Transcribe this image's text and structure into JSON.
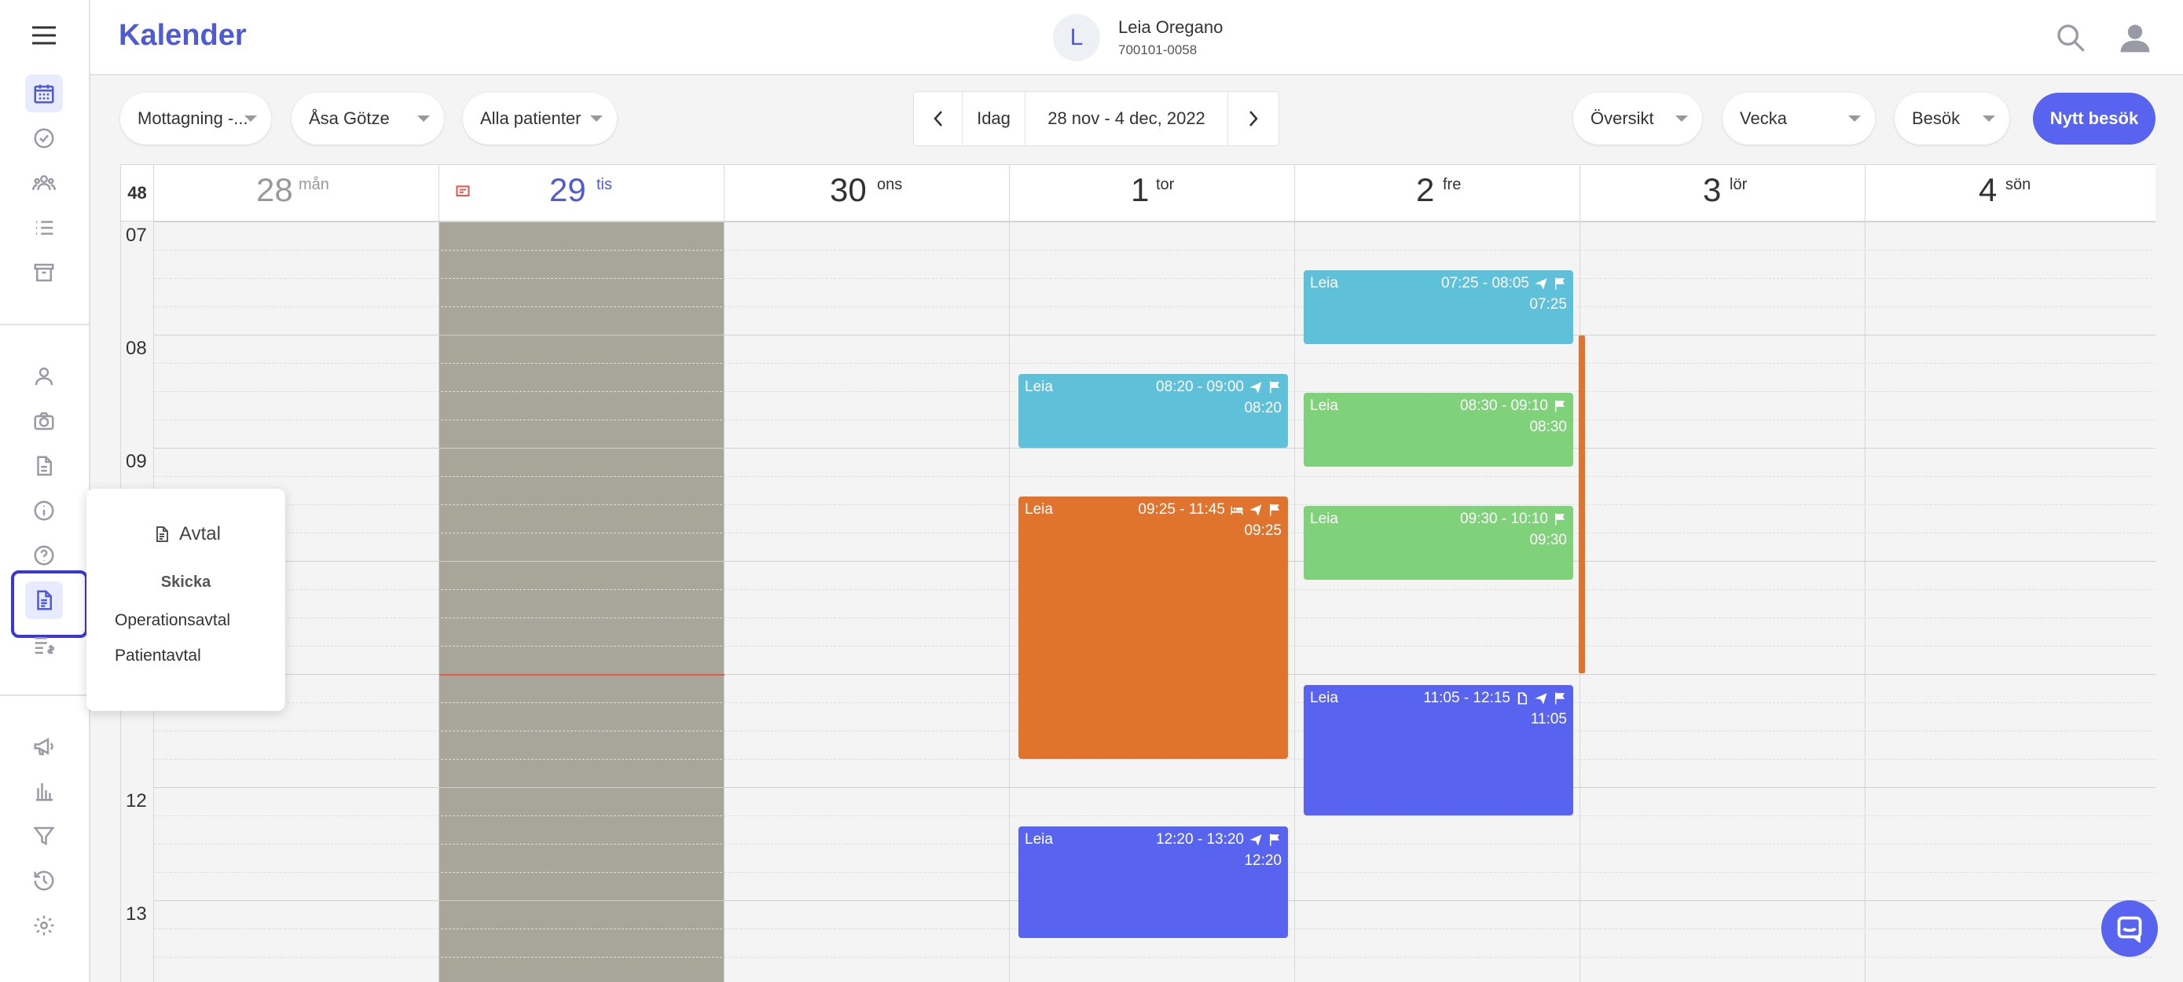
{
  "header": {
    "app_title": "Kalender",
    "patient": {
      "initial": "L",
      "name": "Leia Oregano",
      "id": "700101-0058"
    }
  },
  "sidebar": {
    "icons": [
      "calendar-icon",
      "check-circle-icon",
      "group-icon",
      "list-icon",
      "archive-icon",
      "person-icon",
      "camera-icon",
      "document-icon",
      "info-icon",
      "help-icon",
      "agreement-icon",
      "invoice-icon",
      "megaphone-icon",
      "bar-chart-icon",
      "filter-icon",
      "history-icon",
      "settings-icon"
    ]
  },
  "toolbar": {
    "clinic": "Mottagning -...",
    "staff": "Åsa Götze",
    "patients": "Alla patienter",
    "today": "Idag",
    "range": "28 nov - 4 dec, 2022",
    "view_mode": "Översikt",
    "period": "Vecka",
    "type": "Besök",
    "new_visit": "Nytt besök"
  },
  "calendar": {
    "week": "48",
    "days": [
      {
        "num": "28",
        "name": "mån"
      },
      {
        "num": "29",
        "name": "tis"
      },
      {
        "num": "30",
        "name": "ons"
      },
      {
        "num": "1",
        "name": "tor"
      },
      {
        "num": "2",
        "name": "fre"
      },
      {
        "num": "3",
        "name": "lör"
      },
      {
        "num": "4",
        "name": "sön"
      }
    ],
    "hours": [
      "07",
      "08",
      "09",
      "12",
      "13"
    ],
    "events": [
      {
        "who": "Leia",
        "time": "07:25 - 08:05",
        "start": "07:25"
      },
      {
        "who": "Leia",
        "time": "08:20 - 09:00",
        "start": "08:20"
      },
      {
        "who": "Leia",
        "time": "08:30 - 09:10",
        "start": "08:30"
      },
      {
        "who": "Leia",
        "time": "09:25 - 11:45",
        "start": "09:25"
      },
      {
        "who": "Leia",
        "time": "09:30 - 10:10",
        "start": "09:30"
      },
      {
        "who": "Leia",
        "time": "11:05 - 12:15",
        "start": "11:05"
      },
      {
        "who": "Leia",
        "time": "12:20 - 13:20",
        "start": "12:20"
      }
    ]
  },
  "popover": {
    "title": "Avtal",
    "subtitle": "Skicka",
    "items": [
      "Operationsavtal",
      "Patientavtal"
    ]
  },
  "colors": {
    "accent": "#4f5bd5",
    "blue": "#5fc0d9",
    "green": "#7fd27a",
    "orange": "#e0742e",
    "indigo": "#5864f0",
    "blocked": "#a8a699"
  }
}
